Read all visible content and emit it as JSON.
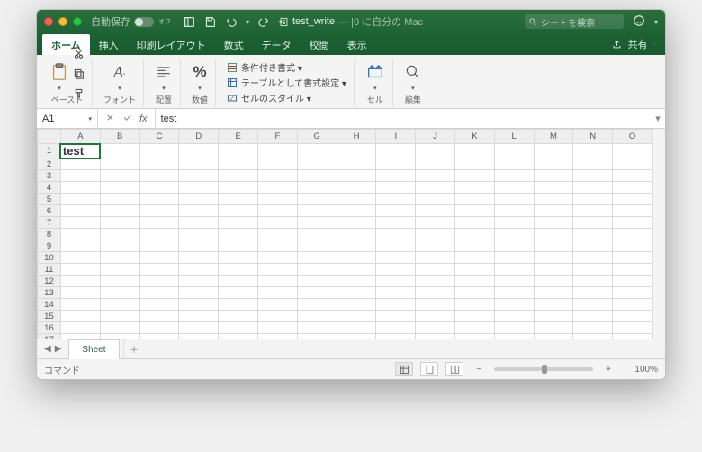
{
  "titlebar": {
    "autosave_label": "自動保存",
    "autosave_state": "オフ",
    "doc_name": "test_write",
    "doc_suffix": " — |0 に自分の Mac",
    "search_placeholder": "シートを検索"
  },
  "tabs": {
    "items": [
      "ホーム",
      "挿入",
      "印刷レイアウト",
      "数式",
      "データ",
      "校閲",
      "表示"
    ],
    "active": 0,
    "share_label": "共有"
  },
  "ribbon": {
    "paste_label": "ペースト",
    "font_label": "フォント",
    "align_label": "配置",
    "number_label": "数値",
    "percent_sym": "%",
    "cond_format": "条件付き書式 ▾",
    "table_format": "テーブルとして書式設定 ▾",
    "cell_styles": "セルのスタイル ▾",
    "cells_label": "セル",
    "edit_label": "編集"
  },
  "fxbar": {
    "name": "A1",
    "fx": "fx",
    "value": "test"
  },
  "grid": {
    "cols": [
      "A",
      "B",
      "C",
      "D",
      "E",
      "F",
      "G",
      "H",
      "I",
      "J",
      "K",
      "L",
      "M",
      "N",
      "O"
    ],
    "row_count": 17,
    "a1_value": "test"
  },
  "sheet_tab": {
    "name": "Sheet"
  },
  "status": {
    "command": "コマンド",
    "zoom": "100%"
  }
}
